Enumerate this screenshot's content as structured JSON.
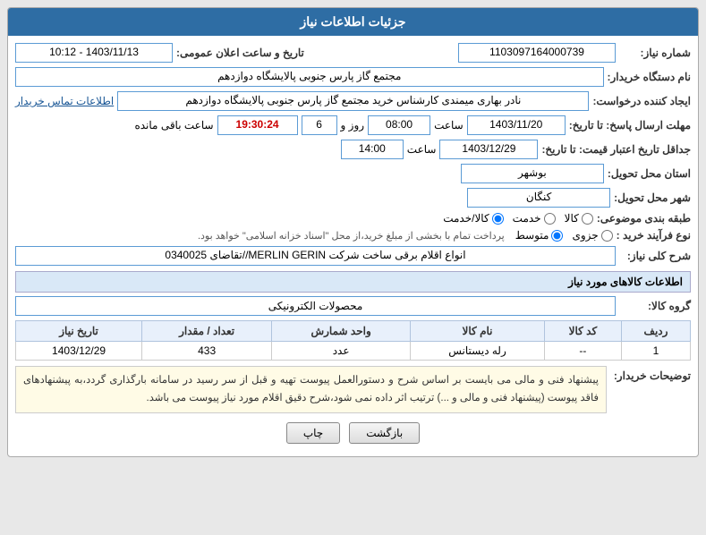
{
  "header": {
    "title": "جزئیات اطلاعات نیاز"
  },
  "fields": {
    "shomareNiaz_label": "شماره نیاز:",
    "shomareNiaz_value": "1103097164000739",
    "namdastgah_label": "نام دستگاه خریدار:",
    "namdastgah_value": "مجتمع گاز پارس جنوبی  پالایشگاه دوازدهم",
    "tarikh_label": "تاریخ و ساعت اعلان عمومی:",
    "tarikh_value": "1403/11/13 - 10:12",
    "ijad_label": "ایجاد کننده درخواست:",
    "ijad_value": "نادر بهاری میمندی کارشناس خرید مجتمع گاز پارس جنوبی  پالایشگاه دوازدهم",
    "ettelaat_link": "اطلاعات تماس خریدار",
    "mohlat_label": "مهلت ارسال پاسخ: تا تاریخ:",
    "mohlat_date": "1403/11/20",
    "mohlat_saat": "08:00",
    "mohlat_rooz": "6",
    "mohlat_mande": "19:30:24",
    "mohlat_mande_label": "ساعت باقی مانده",
    "jadval_label": "جداقل تاریخ اعتبار قیمت: تا تاریخ:",
    "jadval_date": "1403/12/29",
    "jadval_saat": "14:00",
    "ostan_label": "استان محل تحویل:",
    "ostan_value": "بوشهر",
    "shahr_label": "شهر محل تحویل:",
    "shahr_value": "کنگان",
    "tabaqe_label": "طبقه بندی موضوعی:",
    "tabaqe_kala": "کالا",
    "tabaqe_khadamat": "خدمت",
    "tabaqe_kalaKhadamat": "کالا/خدمت",
    "noeFarayand_label": "نوع فرآیند خرید :",
    "noeFarayand_jozvi": "جزوی",
    "noeFarayand_motevaset": "متوسط",
    "noeFarayand_note": "پرداخت تمام با بخشی از مبلغ خرید،از محل \"اسناد خزانه اسلامی\" خواهد بود.",
    "sharcKoli_label": "شرح کلی نیاز:",
    "sharcKoli_value": "انواع اقلام برقی ساخت شرکت MERLIN GERIN//تقاضای 0340025",
    "etelaat_kala_title": "اطلاعات کالاهای مورد نیاز",
    "grohe_kala_label": "گروه کالا:",
    "grohe_kala_value": "محصولات الکترونیکی",
    "table": {
      "headers": [
        "ردیف",
        "کد کالا",
        "نام کالا",
        "واحد شمارش",
        "تعداد / مقدار",
        "تاریخ نیاز"
      ],
      "rows": [
        {
          "radif": "1",
          "kod": "--",
          "nam": "رله دیستانس",
          "vahed": "عدد",
          "tedad": "433",
          "tarikh": "1403/12/29"
        }
      ]
    },
    "touzih_label": "توضیحات خریدار:",
    "touzih_text": "پیشنهاد فنی و مالی می بایست بر اساس شرح و دستورالعمل پیوست تهیه و قبل از سر رسید در سامانه بارگذاری گردد،به پیشنهادهای فاقد پیوست (پیشنهاد فنی و مالی و ...) ترتیب اثر داده نمی شود،شرح دقیق اقلام مورد نیاز پیوست می باشد."
  },
  "buttons": {
    "chap": "چاپ",
    "bazgasht": "بازگشت"
  }
}
